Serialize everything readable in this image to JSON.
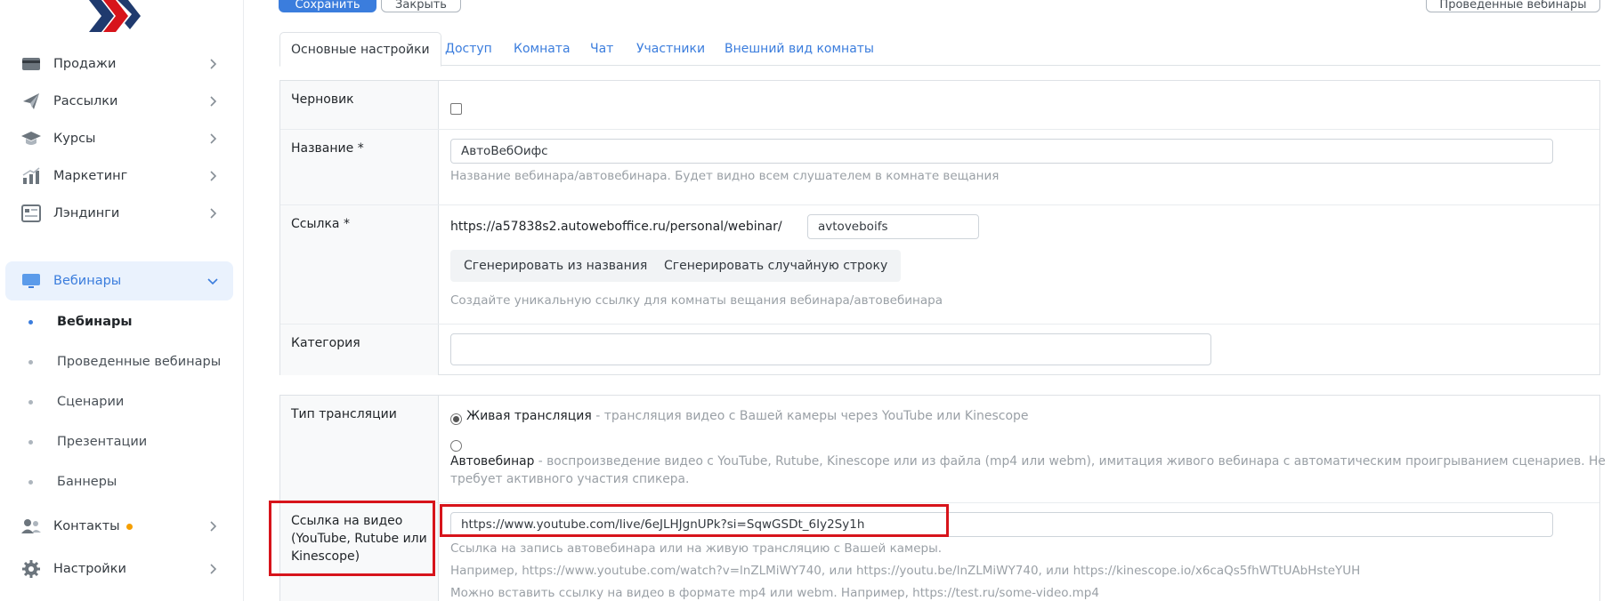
{
  "toolbar": {
    "save_label": "Сохранить",
    "close_label": "Закрыть",
    "past_webinars_label": "Проведенные вебинары"
  },
  "sidebar": {
    "items": [
      {
        "label": "Продажи",
        "icon": "card-icon"
      },
      {
        "label": "Рассылки",
        "icon": "paper-plane-icon"
      },
      {
        "label": "Курсы",
        "icon": "graduation-cap-icon"
      },
      {
        "label": "Маркетинг",
        "icon": "bar-chart-icon"
      },
      {
        "label": "Лэндинги",
        "icon": "landing-page-icon"
      },
      {
        "label": "Вебинары",
        "icon": "monitor-icon"
      },
      {
        "label": "Контакты",
        "icon": "users-icon"
      },
      {
        "label": "Настройки",
        "icon": "gear-icon"
      }
    ],
    "webinar_subitems": [
      "Вебинары",
      "Проведенные вебинары",
      "Сценарии",
      "Презентации",
      "Баннеры"
    ],
    "accent_color": "#3b7ddd",
    "notification_color": "#f59f00"
  },
  "tabs": [
    "Основные настройки",
    "Доступ",
    "Комната",
    "Чат",
    "Участники",
    "Внешний вид комнаты"
  ],
  "form": {
    "draft": {
      "label": "Черновик",
      "checked": false
    },
    "name": {
      "label": "Название *",
      "value": "АвтоВебОифс",
      "hint": "Название вебинара/автовебинара. Будет видно всем слушателем в комнате вещания"
    },
    "link": {
      "label": "Ссылка *",
      "prefix": "https://a57838s2.autoweboffice.ru/personal/webinar/",
      "value": "avtoveboifs",
      "gen_from_name": "Сгенерировать из названия",
      "gen_random": "Сгенерировать случайную строку",
      "hint": "Создайте уникальную ссылку для комнаты вещания вебинара/автовебинара"
    },
    "category": {
      "label": "Категория",
      "value": ""
    },
    "broadcast_type": {
      "label": "Тип трансляции",
      "live_title": "Живая трансляция",
      "live_desc": " - трансляция видео с Вашей камеры через YouTube или Kinescope",
      "auto_title": "Автовебинар",
      "auto_desc_line1": " - воспроизведение видео с YouTube, Rutube, Kinescope или из файла (mp4 или webm), имитация живого вебинара с автоматическим проигрыванием сценариев. Не",
      "auto_desc_line2": "требует активного участия спикера.",
      "selected": "live"
    },
    "video_link": {
      "label_line1": "Ссылка на видео",
      "label_line2": "(YouTube, Rutube или",
      "label_line3": "Kinescope)",
      "value": "https://www.youtube.com/live/6eJLHJgnUPk?si=SqwGSDt_6Iy2Sy1h",
      "hint1": "Ссылка на запись автовебинара или на живую трансляцию с Вашей камеры.",
      "hint2": "Например, https://www.youtube.com/watch?v=lnZLMiWY740, или https://youtu.be/lnZLMiWY740, или https://kinescope.io/x6caQs5fhWTtUAbHsteYUH",
      "hint3": "Можно вставить ссылку на видео в формате mp4 или webm. Например, https://test.ru/some-video.mp4"
    }
  },
  "highlight_color": "#d7141b"
}
